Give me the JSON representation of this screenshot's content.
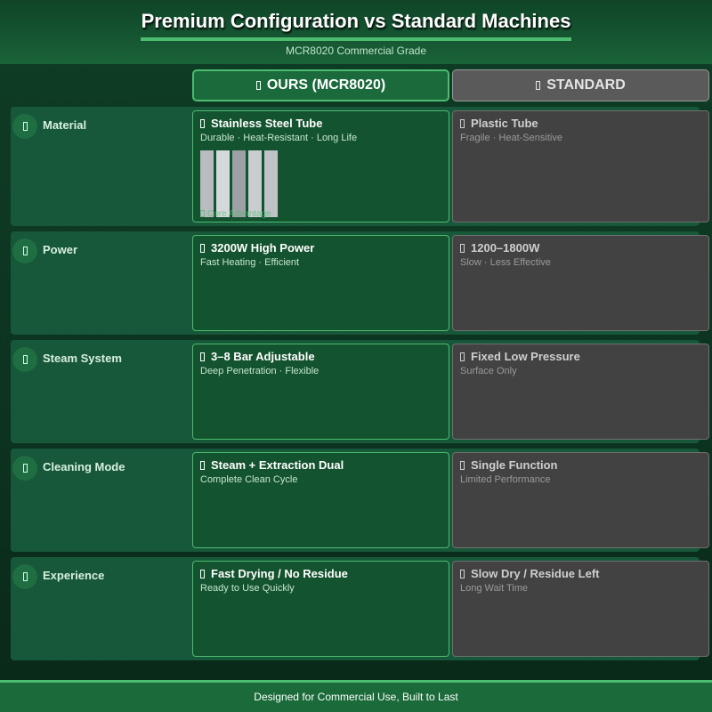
{
  "header": {
    "title": "Premium Configuration vs Standard Machines",
    "subtitle": "MCR8020 Commercial Grade"
  },
  "columns": {
    "ours": {
      "icon": "trophy-icon",
      "label": "OURS (MCR8020)"
    },
    "standard": {
      "icon": "box-icon",
      "label": "STANDARD"
    }
  },
  "rows": [
    {
      "label": "Material",
      "icon": "material-icon",
      "ours": {
        "title": "Stainless Steel Tube",
        "sub": "Durable · Heat-Resistant · Long Life",
        "note": "Core Advantage"
      },
      "standard": {
        "title": "Plastic Tube",
        "sub": "Fragile · Heat-Sensitive"
      }
    },
    {
      "label": "Power",
      "icon": "power-icon",
      "ours": {
        "title": "3200W High Power",
        "sub": "Fast Heating · Efficient"
      },
      "standard": {
        "title": "1200–1800W",
        "sub": "Slow · Less Effective"
      }
    },
    {
      "label": "Steam System",
      "icon": "steam-icon",
      "ours": {
        "title": "3–8 Bar Adjustable",
        "sub": "Deep Penetration · Flexible"
      },
      "standard": {
        "title": "Fixed Low Pressure",
        "sub": "Surface Only"
      }
    },
    {
      "label": "Cleaning Mode",
      "icon": "cleaning-icon",
      "ours": {
        "title": "Steam + Extraction Dual",
        "sub": "Complete Clean Cycle"
      },
      "standard": {
        "title": "Single Function",
        "sub": "Limited Performance"
      }
    },
    {
      "label": "Experience",
      "icon": "experience-icon",
      "ours": {
        "title": "Fast Drying / No Residue",
        "sub": "Ready to Use Quickly"
      },
      "standard": {
        "title": "Slow Dry / Residue Left",
        "sub": "Long Wait Time"
      }
    }
  ],
  "footer": {
    "text": "Designed for Commercial Use, Built to Last"
  },
  "colors": {
    "accent": "#4cbc6e",
    "ours_bg": "#14532f",
    "standard_bg": "#424242"
  }
}
